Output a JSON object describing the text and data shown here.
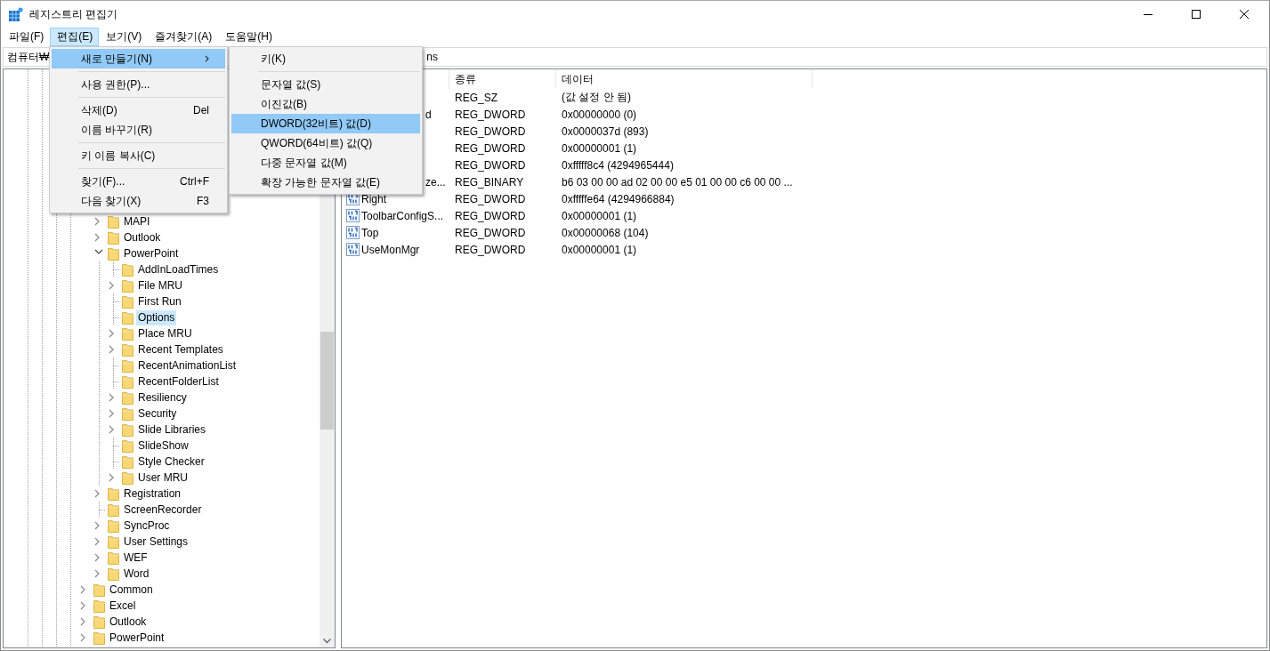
{
  "window": {
    "title": "레지스트리 편집기"
  },
  "menu_bar": [
    {
      "label": "파일(F)",
      "selected": false
    },
    {
      "label": "편집(E)",
      "selected": true
    },
    {
      "label": "보기(V)",
      "selected": false
    },
    {
      "label": "즐겨찾기(A)",
      "selected": false
    },
    {
      "label": "도움말(H)",
      "selected": false
    }
  ],
  "address_bar": {
    "segments": [
      "컴퓨터₩",
      "ns"
    ]
  },
  "tree": {
    "continued_items": [
      {
        "label": "MAPI",
        "expandable": true,
        "expanded": false,
        "selected": false
      },
      {
        "label": "Outlook",
        "expandable": true,
        "expanded": false,
        "selected": false
      },
      {
        "label": "PowerPoint",
        "expandable": true,
        "expanded": true,
        "selected": false,
        "children": [
          {
            "label": "AddInLoadTimes",
            "expandable": false,
            "selected": false
          },
          {
            "label": "File MRU",
            "expandable": true,
            "expanded": false,
            "selected": false
          },
          {
            "label": "First Run",
            "expandable": false,
            "selected": false
          },
          {
            "label": "Options",
            "expandable": false,
            "selected": true
          },
          {
            "label": "Place MRU",
            "expandable": true,
            "expanded": false,
            "selected": false
          },
          {
            "label": "Recent Templates",
            "expandable": true,
            "expanded": false,
            "selected": false
          },
          {
            "label": "RecentAnimationList",
            "expandable": false,
            "selected": false
          },
          {
            "label": "RecentFolderList",
            "expandable": false,
            "selected": false
          },
          {
            "label": "Resiliency",
            "expandable": true,
            "expanded": false,
            "selected": false
          },
          {
            "label": "Security",
            "expandable": true,
            "expanded": false,
            "selected": false
          },
          {
            "label": "Slide Libraries",
            "expandable": true,
            "expanded": false,
            "selected": false
          },
          {
            "label": "SlideShow",
            "expandable": false,
            "selected": false
          },
          {
            "label": "Style Checker",
            "expandable": false,
            "selected": false
          },
          {
            "label": "User MRU",
            "expandable": true,
            "expanded": false,
            "selected": false
          }
        ]
      },
      {
        "label": "Registration",
        "expandable": true,
        "expanded": false,
        "selected": false
      },
      {
        "label": "ScreenRecorder",
        "expandable": false,
        "selected": false
      },
      {
        "label": "SyncProc",
        "expandable": true,
        "expanded": false,
        "selected": false
      },
      {
        "label": "User Settings",
        "expandable": true,
        "expanded": false,
        "selected": false
      },
      {
        "label": "WEF",
        "expandable": true,
        "expanded": false,
        "selected": false
      },
      {
        "label": "Word",
        "expandable": true,
        "expanded": false,
        "selected": false
      }
    ],
    "items": [
      {
        "label": "Common",
        "expandable": true,
        "expanded": false,
        "selected": false
      },
      {
        "label": "Excel",
        "expandable": true,
        "expanded": false,
        "selected": false
      },
      {
        "label": "Outlook",
        "expandable": true,
        "expanded": false,
        "selected": false
      },
      {
        "label": "PowerPoint",
        "expandable": true,
        "expanded": false,
        "selected": false
      }
    ]
  },
  "values": {
    "columns": [
      {
        "label": "종류"
      },
      {
        "label": "데이터"
      }
    ],
    "rows": [
      {
        "type": "REG_SZ",
        "data": "(값 설정 안 됨)"
      },
      {
        "covered": true,
        "name": "d",
        "type": "REG_DWORD",
        "data": "0x00000000 (0)"
      },
      {
        "type": "REG_DWORD",
        "data": "0x0000037d (893)"
      },
      {
        "type": "REG_DWORD",
        "data": "0x00000001 (1)"
      },
      {
        "type": "REG_DWORD",
        "data": "0xfffff8c4 (4294965444)"
      },
      {
        "covered": true,
        "name": "ze...",
        "type": "REG_BINARY",
        "data": "b6 03 00 00 ad 02 00 00 e5 01 00 00 c6 00 00 ..."
      },
      {
        "covered": false,
        "name": "Right",
        "type": "REG_DWORD",
        "data": "0xfffffe64 (4294966884)"
      },
      {
        "covered": false,
        "name": "ToolbarConfigS...",
        "type": "REG_DWORD",
        "data": "0x00000001 (1)"
      },
      {
        "covered": false,
        "name": "Top",
        "type": "REG_DWORD",
        "data": "0x00000068 (104)"
      },
      {
        "covered": false,
        "name": "UseMonMgr",
        "type": "REG_DWORD",
        "data": "0x00000001 (1)"
      }
    ]
  },
  "edit_menu": {
    "items": [
      {
        "kind": "item",
        "label": "새로 만들기(N)",
        "submenu": true,
        "selected": true
      },
      {
        "kind": "separator"
      },
      {
        "kind": "item",
        "label": "사용 권한(P)...",
        "submenu": false,
        "selected": false
      },
      {
        "kind": "separator"
      },
      {
        "kind": "item",
        "label": "삭제(D)",
        "shortcut": "Del",
        "submenu": false,
        "selected": false
      },
      {
        "kind": "item",
        "label": "이름 바꾸기(R)",
        "submenu": false,
        "selected": false
      },
      {
        "kind": "separator"
      },
      {
        "kind": "item",
        "label": "키 이름 복사(C)",
        "submenu": false,
        "selected": false
      },
      {
        "kind": "separator"
      },
      {
        "kind": "item",
        "label": "찾기(F)...",
        "shortcut": "Ctrl+F",
        "submenu": false,
        "selected": false
      },
      {
        "kind": "item",
        "label": "다음 찾기(X)",
        "shortcut": "F3",
        "submenu": false,
        "selected": false
      }
    ]
  },
  "new_submenu": {
    "items": [
      {
        "kind": "item",
        "label": "키(K)",
        "submenu": false,
        "selected": false
      },
      {
        "kind": "separator"
      },
      {
        "kind": "item",
        "label": "문자열 값(S)",
        "submenu": false,
        "selected": false
      },
      {
        "kind": "item",
        "label": "이진값(B)",
        "submenu": false,
        "selected": false
      },
      {
        "kind": "item",
        "label": "DWORD(32비트) 값(D)",
        "submenu": false,
        "selected": true
      },
      {
        "kind": "item",
        "label": "QWORD(64비트) 값(Q)",
        "submenu": false,
        "selected": false
      },
      {
        "kind": "item",
        "label": "다중 문자열 값(M)",
        "submenu": false,
        "selected": false
      },
      {
        "kind": "item",
        "label": "확장 가능한 문자열 값(E)",
        "submenu": false,
        "selected": false
      }
    ]
  }
}
